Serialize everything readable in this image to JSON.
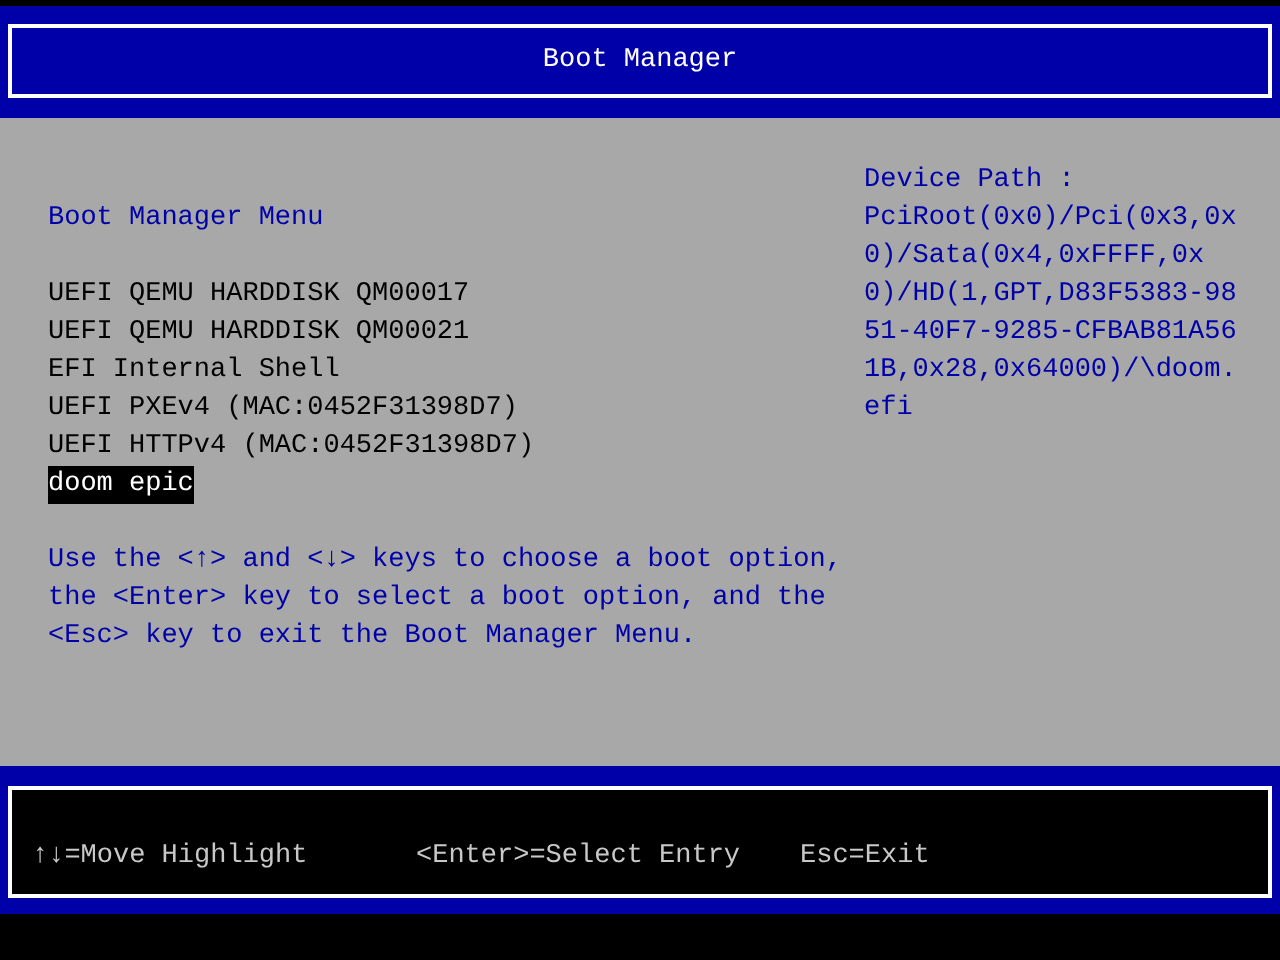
{
  "header": {
    "title": "Boot Manager"
  },
  "menu": {
    "title": "Boot Manager Menu",
    "items": [
      {
        "label": "UEFI QEMU HARDDISK QM00017",
        "selected": false
      },
      {
        "label": "UEFI QEMU HARDDISK QM00021",
        "selected": false
      },
      {
        "label": "EFI Internal Shell",
        "selected": false
      },
      {
        "label": "UEFI PXEv4 (MAC:0452F31398D7)",
        "selected": false
      },
      {
        "label": "UEFI HTTPv4 (MAC:0452F31398D7)",
        "selected": false
      },
      {
        "label": "doom epic",
        "selected": true
      }
    ],
    "help": "Use the <↑> and <↓> keys to choose a boot option, the <Enter> key to select a boot option, and the <Esc> key to exit the Boot Manager Menu."
  },
  "device_path": {
    "label": "Device Path :",
    "value": "PciRoot(0x0)/Pci(0x3,0x0)/Sata(0x4,0xFFFF,0x0)/HD(1,GPT,D83F5383-9851-40F7-9285-CFBAB81A561B,0x28,0x64000)/\\doom.efi"
  },
  "footer": [
    "↑↓=Move Highlight",
    "<Enter>=Select Entry",
    "Esc=Exit"
  ]
}
